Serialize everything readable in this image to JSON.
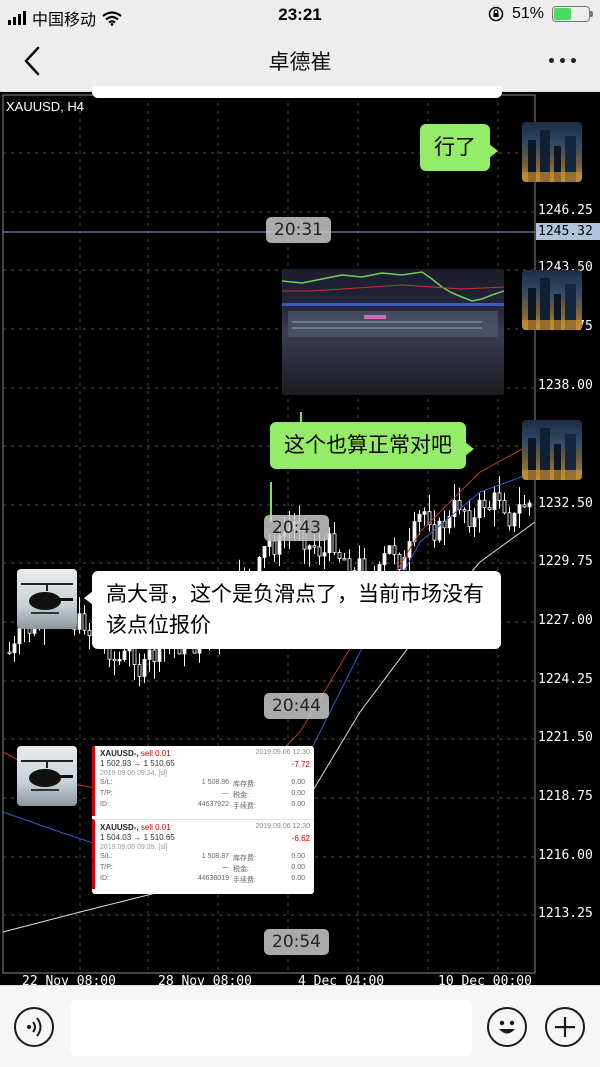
{
  "status_bar": {
    "carrier": "中国移动",
    "time": "23:21",
    "battery_percent": "51%",
    "battery_level": 0.51
  },
  "nav": {
    "title": "卓德崔"
  },
  "chart": {
    "symbol_label": "XAUUSD, H4",
    "price_ticks": [
      "1246.25",
      "1238.00",
      "1232.50",
      "1229.75",
      "1227.00",
      "1224.25",
      "1221.50",
      "1218.75",
      "1216.00",
      "1213.25"
    ],
    "partial_ticks": [
      "00",
      "1243.50",
      "1240.75",
      "25"
    ],
    "current_price": "1245.32",
    "date_ticks": [
      "22 Nov 08:00",
      "28 Nov 08:00",
      "4 Dec 04:00",
      "10 Dec 00:00"
    ]
  },
  "messages": [
    {
      "type": "sent",
      "text": "行了"
    },
    {
      "type": "time",
      "text": "20:31"
    },
    {
      "type": "sent_image"
    },
    {
      "type": "sent",
      "text": "这个也算正常对吧"
    },
    {
      "type": "time",
      "text": "20:43"
    },
    {
      "type": "received",
      "text": "高大哥，这个是负滑点了，当前市场没有该点位报价"
    },
    {
      "type": "time",
      "text": "20:44"
    },
    {
      "type": "received_image"
    },
    {
      "type": "time",
      "text": "20:54"
    }
  ],
  "trades": [
    {
      "symbol": "XAUUSD-",
      "side": "sell 0.01",
      "prices": "1 502.93 → 1 510.65",
      "open_time": "2019.09.06 09:34, [sl]",
      "close_time": "2019.09.06 12:30",
      "profit": "-7.72",
      "sl_label": "S/L:",
      "sl": "1 508.86",
      "tp_label": "T/P:",
      "tp": "—",
      "id_label": "ID:",
      "id": "44637922",
      "swap_label": "库存费:",
      "swap": "0.00",
      "tax_label": "税金:",
      "tax": "0.00",
      "commission_label": "手续费:",
      "commission": "0.00"
    },
    {
      "symbol": "XAUUSD-",
      "side": "sell 0.01",
      "prices": "1 504.03 → 1 510.65",
      "open_time": "2019.09.06 09:35, [sl]",
      "close_time": "2019.09.06 12:30",
      "profit": "-6.62",
      "sl_label": "S/L:",
      "sl": "1 508.87",
      "tp_label": "T/P:",
      "tp": "—",
      "id_label": "ID:",
      "id": "44638019",
      "swap_label": "库存费:",
      "swap": "0.00",
      "tax_label": "税金:",
      "tax": "0.00",
      "commission_label": "手续费:",
      "commission": "0.00"
    }
  ],
  "input_bar": {
    "voice_icon": "voice-icon",
    "emoji_icon": "emoji-icon",
    "plus_icon": "plus-icon"
  },
  "colors": {
    "sent_bubble": "#95ec69",
    "received_bubble": "#ffffff",
    "chart_background": "#000000",
    "candle": "#ffffff",
    "current_price_tag": "#b0c4de"
  }
}
